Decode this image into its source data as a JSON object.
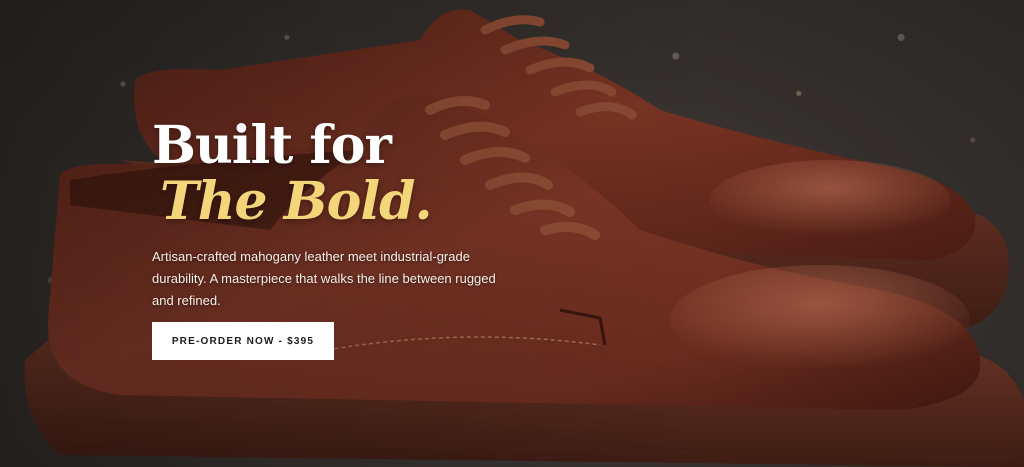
{
  "hero": {
    "headline_line1": "Built for",
    "headline_line2": "The Bold.",
    "description": "Artisan-crafted mahogany leather meet industrial-grade durability. A masterpiece that walks the line between rugged and refined.",
    "cta_label": "PRE-ORDER NOW - $395"
  },
  "colors": {
    "accent": "#f3d57a",
    "leather": "#6b2e1f",
    "cta_background": "#ffffff"
  },
  "image": {
    "subject": "mahogany-leather-derby-shoes"
  }
}
